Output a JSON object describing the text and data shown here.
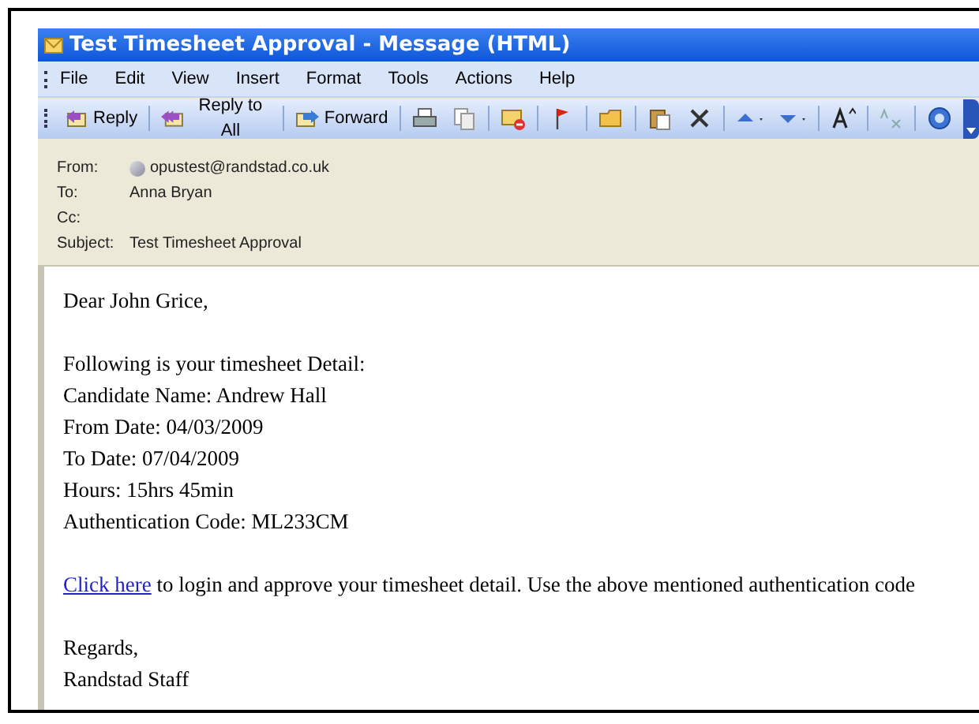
{
  "window": {
    "title": "Test Timesheet Approval - Message (HTML)"
  },
  "menu": [
    "File",
    "Edit",
    "View",
    "Insert",
    "Format",
    "Tools",
    "Actions",
    "Help"
  ],
  "toolbar": [
    {
      "kind": "reply",
      "label": "Reply"
    },
    {
      "kind": "reply-all",
      "label": "Reply to All"
    },
    {
      "kind": "forward",
      "label": "Forward"
    },
    {
      "kind": "print"
    },
    {
      "kind": "copy"
    },
    {
      "kind": "mail"
    },
    {
      "kind": "flag"
    },
    {
      "kind": "folder"
    },
    {
      "kind": "paste"
    },
    {
      "kind": "delete"
    },
    {
      "kind": "up"
    },
    {
      "kind": "down"
    },
    {
      "kind": "font"
    },
    {
      "kind": "abc"
    },
    {
      "kind": "help"
    }
  ],
  "header": [
    {
      "label": "From:",
      "value": "opustest@randstad.co.uk",
      "kind": "sender"
    },
    {
      "label": "To:",
      "value": "Anna Bryan"
    },
    {
      "label": "Cc:"
    },
    {
      "label": "Subject:",
      "value": "Test Timesheet Approval"
    }
  ],
  "body": {
    "greeting": "Dear John Grice,",
    "details": [
      "Following is your timesheet Detail:",
      "Candidate Name: Andrew Hall",
      "From Date: 04/03/2009",
      "To Date: 07/04/2009",
      "Hours: 15hrs 45min",
      "Authentication Code: ML233CM"
    ],
    "link": "Click here",
    "link_text": "to login and approve your timesheet detail. Use the above mentioned authentication code",
    "closing": "Regards,",
    "signature": "Randstad Staff"
  }
}
